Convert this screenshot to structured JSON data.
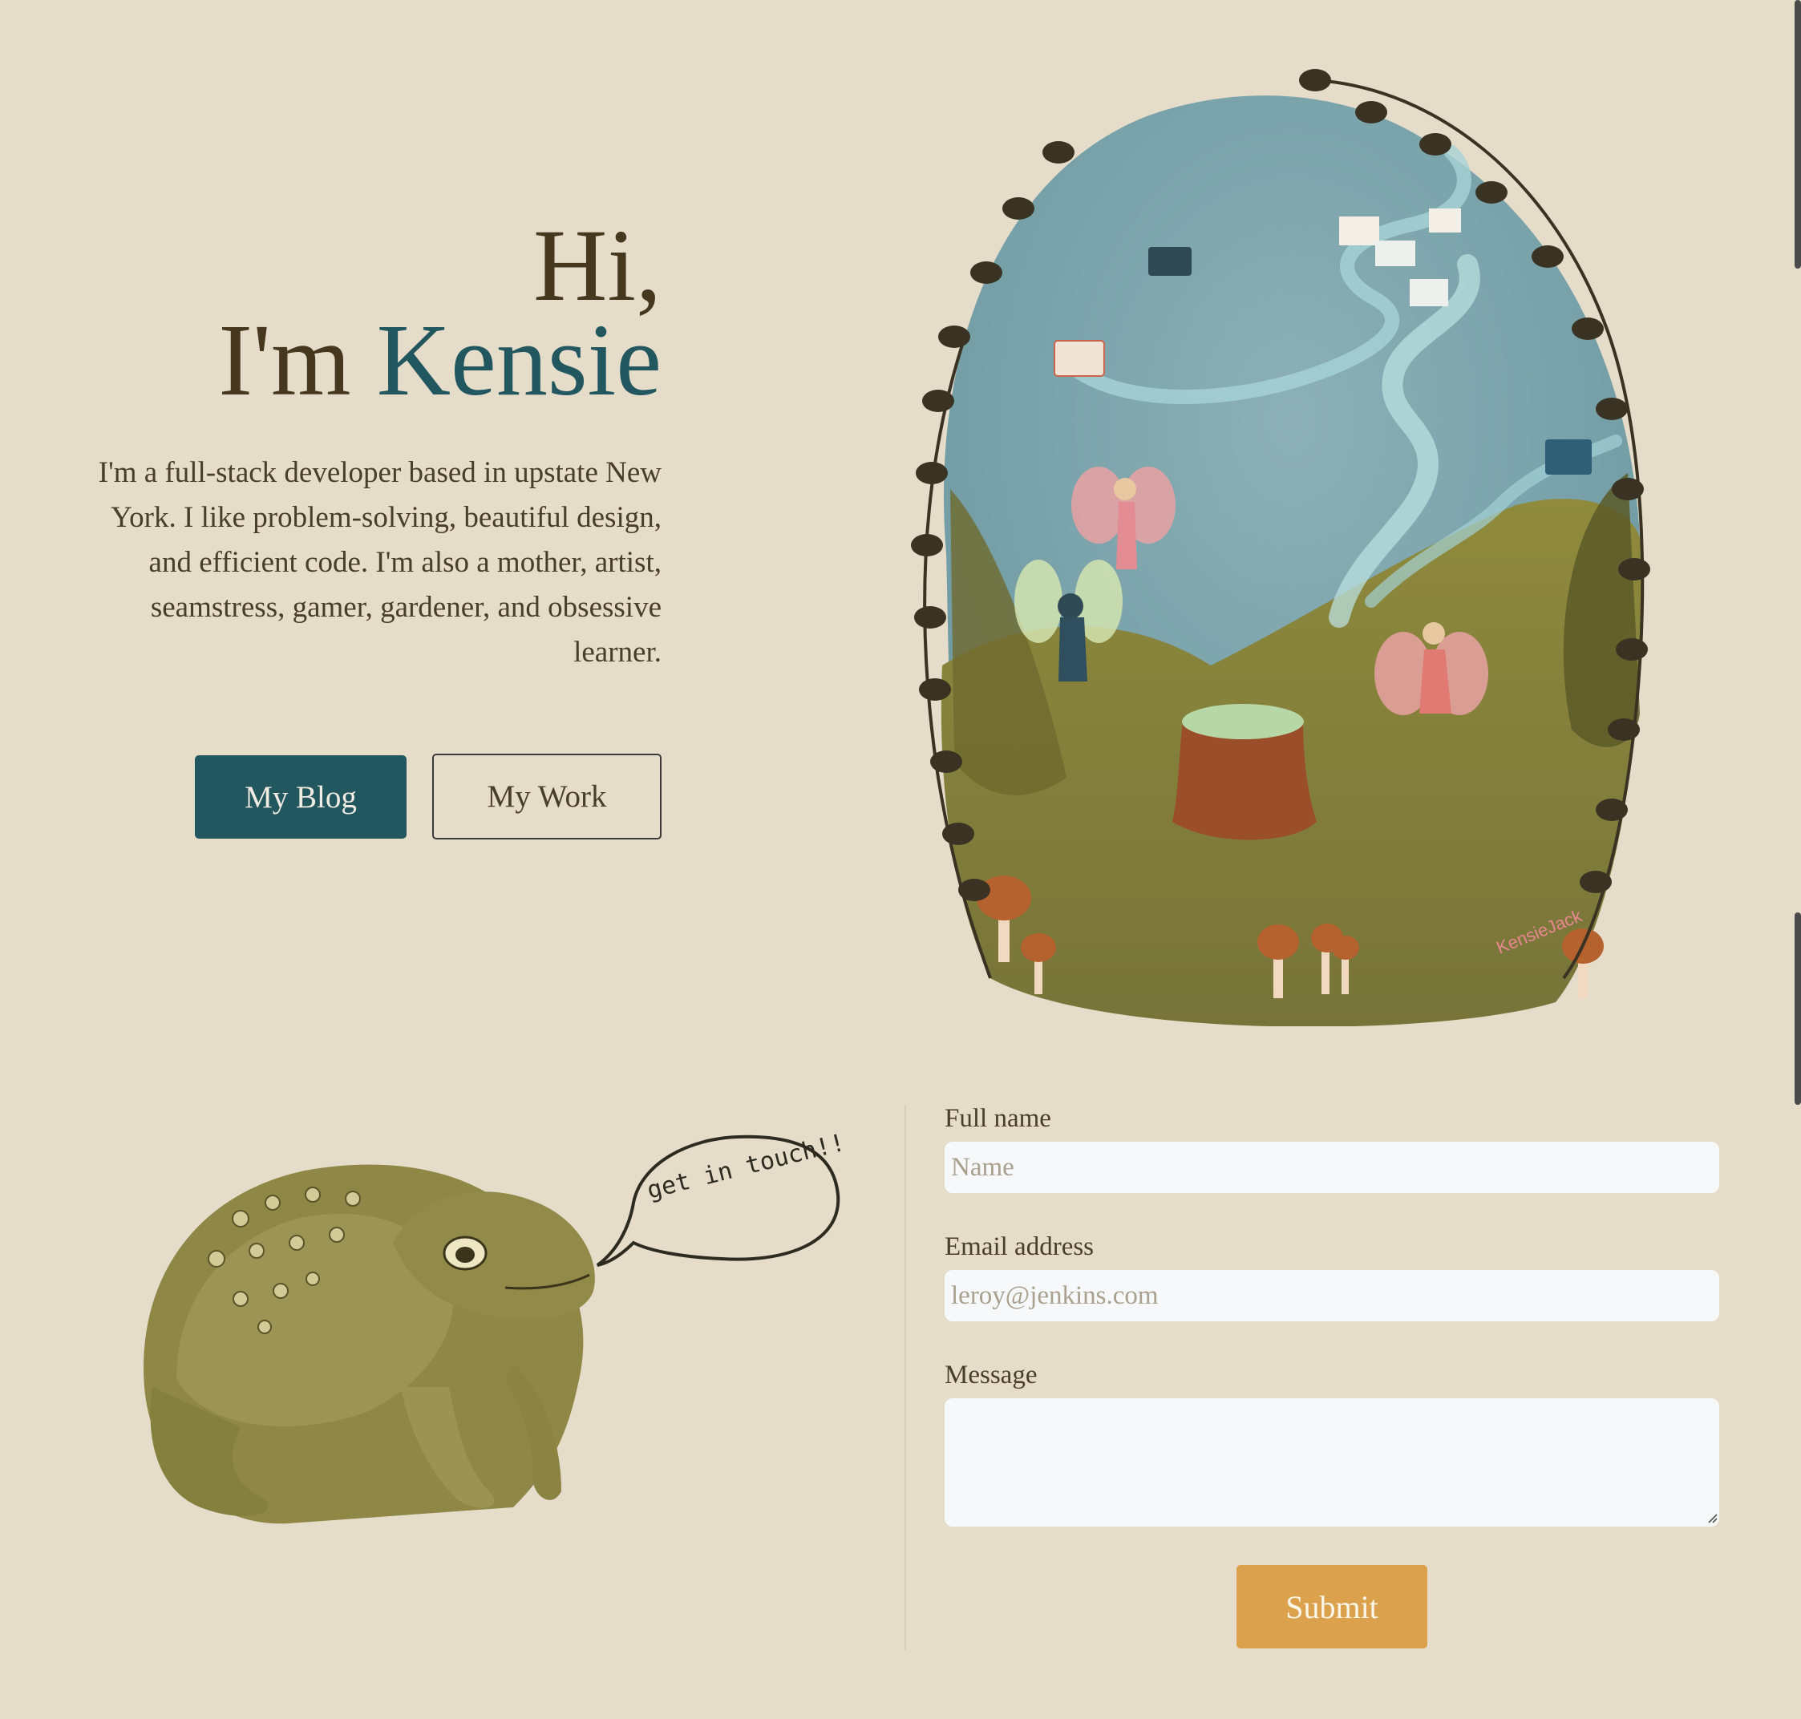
{
  "hero": {
    "greeting": "Hi,",
    "intro_prefix": "I'm ",
    "name": "Kensie",
    "description": "I'm a full-stack developer based in upstate New York. I like problem-solving, beautiful design, and efficient code. I'm also a mother, artist, seamstress, gamer, gardener, and obsessive learner.",
    "buttons": {
      "blog_label": "My Blog",
      "work_label": "My Work"
    },
    "illustration_signature": "KensieJack"
  },
  "contact": {
    "speech_bubble_text": "get in touch!!",
    "full_name_label": "Full name",
    "full_name_placeholder": "Name",
    "email_label": "Email address",
    "email_placeholder": "leroy@jenkins.com",
    "message_label": "Message",
    "submit_label": "Submit"
  },
  "colors": {
    "background": "#e5dcc9",
    "accent_teal": "#235760",
    "heading_brown": "#45381f",
    "submit_orange": "#dba14c",
    "input_bg": "#f7f8fa"
  }
}
